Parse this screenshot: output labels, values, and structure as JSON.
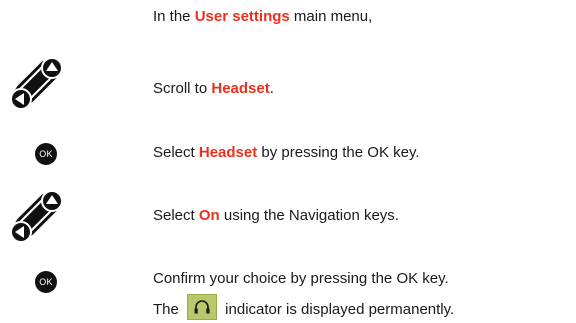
{
  "steps": [
    {
      "pre": "In the ",
      "highlight": "User settings",
      "post": " main menu,"
    },
    {
      "pre": "Scroll to ",
      "highlight": "Headset",
      "post": "."
    },
    {
      "pre": "Select ",
      "highlight": "Headset",
      "post": " by pressing the OK key."
    },
    {
      "pre": "Select ",
      "highlight": "On",
      "post": " using the Navigation keys."
    },
    {
      "pre": "Confirm your choice by pressing the OK key.",
      "highlight": "",
      "post": ""
    },
    {
      "pre": "The ",
      "highlight": "",
      "post": " indicator is displayed permanently."
    }
  ],
  "ok_key_label": "OK",
  "icons": [
    "navigation-keys-icon",
    "ok-key-icon",
    "headset-indicator-icon"
  ],
  "colors": {
    "highlight": "#e8321e",
    "key": "#111111",
    "indicator_bg": "#b8c86a"
  }
}
